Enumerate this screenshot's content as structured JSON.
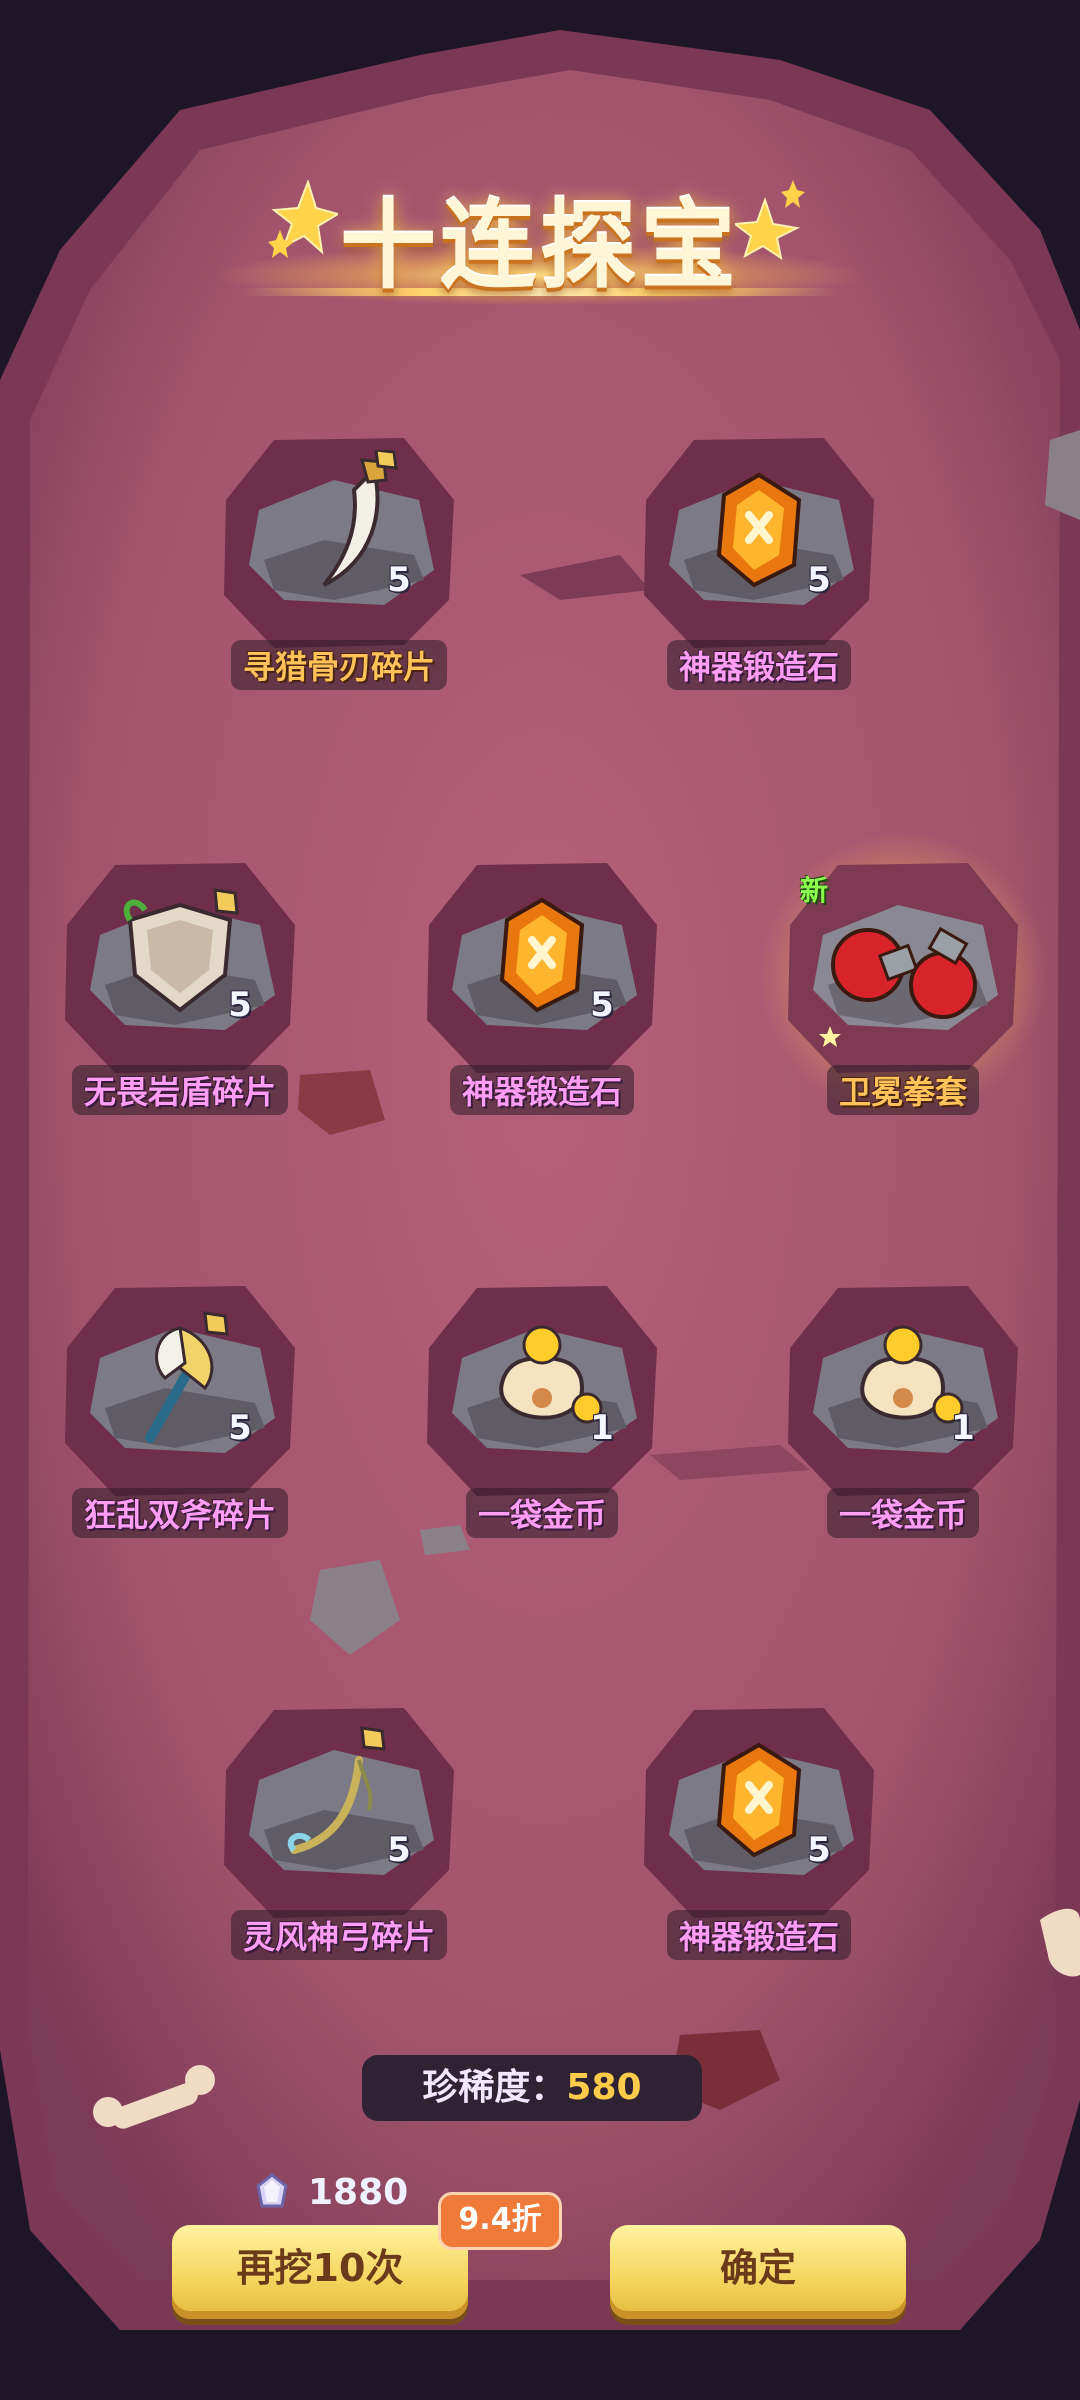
{
  "title": "十连探宝",
  "items": [
    {
      "name": "寻猎骨刃碎片",
      "count": "5",
      "label_color": "gold",
      "icon": "bone-blade-shard-icon"
    },
    {
      "name": "神器锻造石",
      "count": "5",
      "label_color": "pink",
      "icon": "artifact-forge-stone-icon"
    },
    {
      "name": "无畏岩盾碎片",
      "count": "5",
      "label_color": "pink",
      "icon": "rock-shield-shard-icon"
    },
    {
      "name": "神器锻造石",
      "count": "5",
      "label_color": "pink",
      "icon": "artifact-forge-stone-icon"
    },
    {
      "name": "卫冕拳套",
      "count": "",
      "label_color": "gold",
      "icon": "boxing-gloves-icon",
      "new": "新"
    },
    {
      "name": "狂乱双斧碎片",
      "count": "5",
      "label_color": "pink",
      "icon": "frenzy-axes-shard-icon"
    },
    {
      "name": "一袋金币",
      "count": "1",
      "label_color": "pink",
      "icon": "coin-bag-icon"
    },
    {
      "name": "一袋金币",
      "count": "1",
      "label_color": "pink",
      "icon": "coin-bag-icon"
    },
    {
      "name": "灵风神弓碎片",
      "count": "5",
      "label_color": "pink",
      "icon": "wind-bow-shard-icon"
    },
    {
      "name": "神器锻造石",
      "count": "5",
      "label_color": "pink",
      "icon": "artifact-forge-stone-icon"
    }
  ],
  "rarity": {
    "label": "珍稀度：",
    "value": "580"
  },
  "cost": {
    "amount": "1880",
    "icon": "crystal-icon"
  },
  "buttons": {
    "dig_again": "再挖10次",
    "confirm": "确定",
    "discount": "9.4折"
  },
  "colors": {
    "label_pink": "#ff9ef4",
    "label_gold": "#ffc35a",
    "button": "#f5d761",
    "accent_orange": "#f07a3a"
  }
}
